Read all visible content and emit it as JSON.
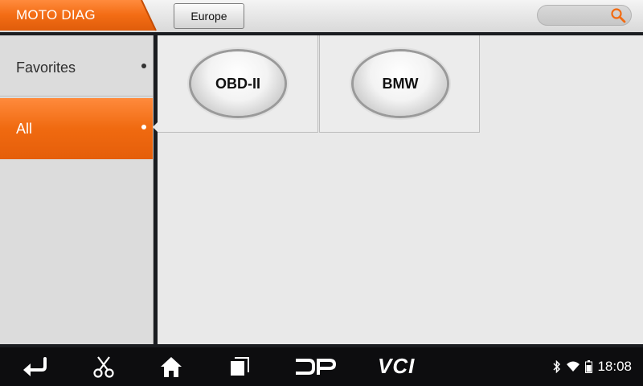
{
  "header": {
    "app_title": "MOTO DIAG",
    "region_button": "Europe",
    "search_icon": "search-icon",
    "accent_color": "#f26b12"
  },
  "sidebar": {
    "items": [
      {
        "label": "Favorites",
        "selected": false
      },
      {
        "label": "All",
        "selected": true
      }
    ]
  },
  "tiles": [
    {
      "label": "OBD-II"
    },
    {
      "label": "BMW"
    }
  ],
  "navbar": {
    "icons": [
      "back-icon",
      "screenshot-scissors-icon",
      "home-icon",
      "recent-apps-icon",
      "dp-icon",
      "vci-icon"
    ],
    "dp_label": "DP",
    "vci_label": "VCI",
    "status_icons": [
      "bluetooth-icon",
      "wifi-icon",
      "battery-icon"
    ],
    "time": "18:08"
  }
}
